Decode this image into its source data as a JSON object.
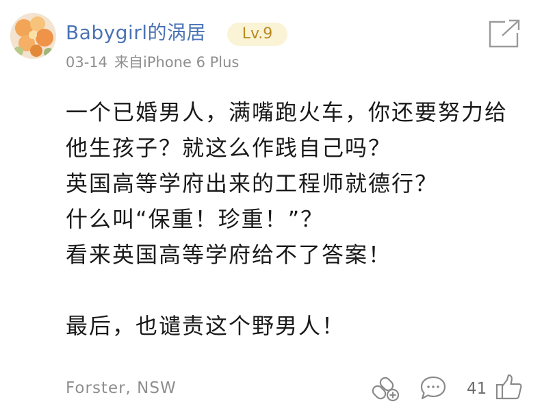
{
  "post": {
    "author": "Babygirl的涡居",
    "level": "Lv.9",
    "date": "03-14",
    "source": "来自iPhone 6 Plus",
    "lines": [
      "一个已婚男人，满嘴跑火车，你还要努力给",
      "他生孩子？就这么作践自己吗？",
      "英国高等学府出来的工程师就德行？",
      "什么叫“保重！珍重！”？",
      "看来英国高等学府给不了答案！",
      "最后，也谴责这个野男人！"
    ],
    "location": "Forster, NSW",
    "like_count": "41"
  },
  "icons": {
    "share": "share-icon",
    "relay": "link-relay-icon",
    "comment": "comment-icon",
    "like": "thumbs-up-icon"
  },
  "colors": {
    "username": "#4a73b5",
    "badge_bg": "#fbf3d6",
    "badge_text": "#b88a20",
    "meta": "#8e8e8e",
    "body": "#1a1a1a"
  }
}
